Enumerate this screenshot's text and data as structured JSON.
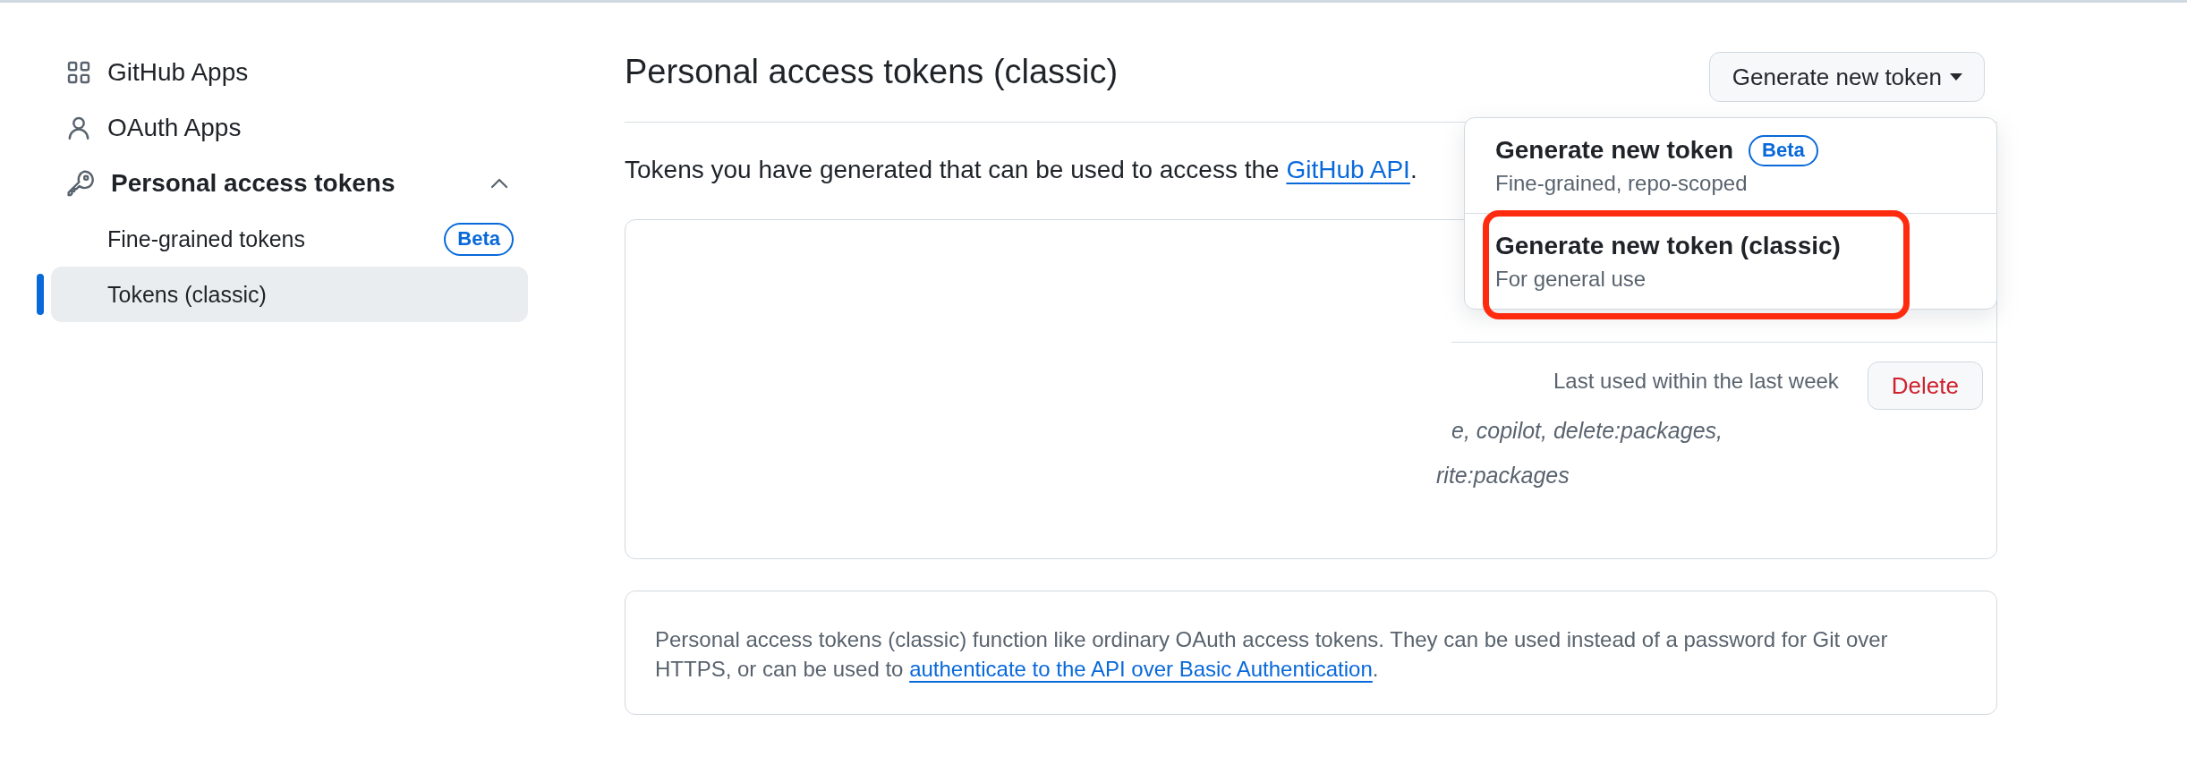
{
  "sidebar": {
    "items": [
      {
        "label": "GitHub Apps",
        "selected": false
      },
      {
        "label": "OAuth Apps",
        "selected": false
      },
      {
        "label": "Personal access tokens",
        "selected": false,
        "expanded": true,
        "children": [
          {
            "label": "Fine-grained tokens",
            "selected": false,
            "badge": "Beta"
          },
          {
            "label": "Tokens (classic)",
            "selected": true
          }
        ]
      }
    ]
  },
  "header": {
    "title": "Personal access tokens (classic)",
    "generate_button": {
      "label": "Generate new token",
      "expanded": true,
      "menu": [
        {
          "title": "Generate new token",
          "badge": "Beta",
          "subtitle": "Fine-grained, repo-scoped",
          "highlighted": false
        },
        {
          "title": "Generate new token (classic)",
          "subtitle": "For general use",
          "highlighted": true
        }
      ]
    }
  },
  "description": {
    "text": "Tokens you have generated that can be used to access the ",
    "link": "GitHub API",
    "text_after": "."
  },
  "token_list": {
    "rows": [
      {
        "last_used": "Last used within the last week",
        "delete_button": "Delete",
        "scopes": [
          "e, copilot, delete:packages,",
          "rite:packages"
        ]
      }
    ]
  },
  "note": {
    "text": "Personal access tokens (classic) function like ordinary OAuth access tokens. They can be used instead of a password for Git over HTTPS, or can be used to ",
    "link": "authenticate to the API over Basic Authentication",
    "text_after": "."
  }
}
